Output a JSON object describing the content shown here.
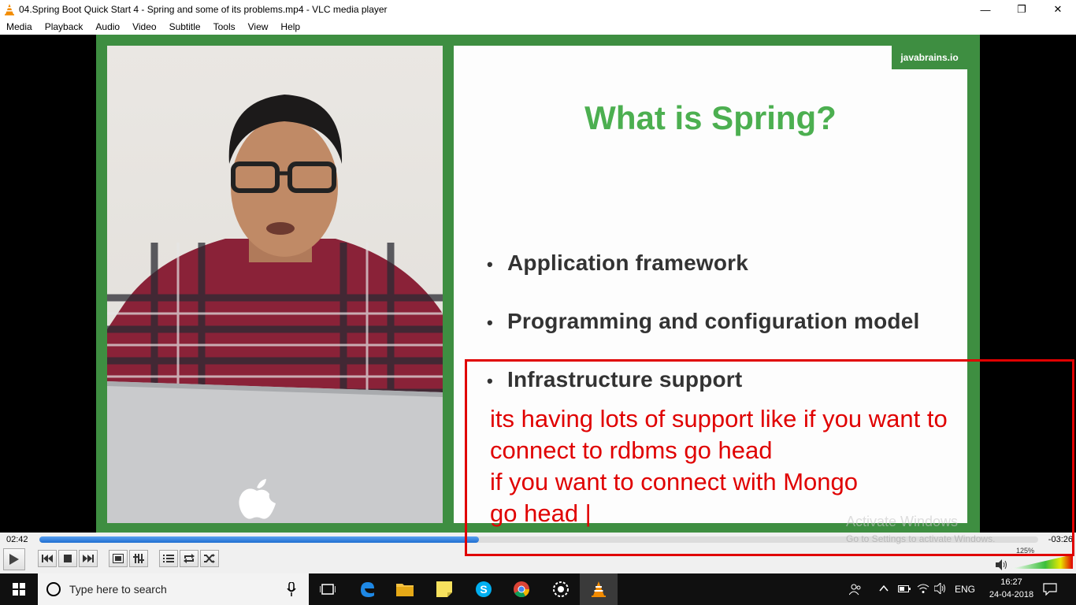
{
  "window": {
    "title": "04.Spring Boot Quick Start 4 - Spring and some of its problems.mp4 - VLC media player",
    "minimize_icon": "minimize-icon",
    "maximize_icon": "restore-icon",
    "close_icon": "close-icon"
  },
  "menu": [
    "Media",
    "Playback",
    "Audio",
    "Video",
    "Subtitle",
    "Tools",
    "View",
    "Help"
  ],
  "slide": {
    "brand": "javabrains.io",
    "title": "What is Spring?",
    "bullets": [
      "Application framework",
      "Programming and configuration model",
      "Infrastructure support"
    ],
    "title_color": "#4caf50",
    "frame_color": "#3e8e41"
  },
  "annotation": {
    "text": "its having lots of support like if you want to\nconnect to rdbms go head\nif you want to connect with Mongo\ngo head |",
    "color": "#e00000"
  },
  "watermark": {
    "line1": "Activate Windows",
    "line2": "Go to Settings to activate Windows."
  },
  "player": {
    "elapsed": "02:42",
    "remaining": "-03:26",
    "progress_fraction": 0.44,
    "volume_label": "125%",
    "volume_fraction": 1.0
  },
  "taskbar": {
    "search_placeholder": "Type here to search",
    "language": "ENG",
    "time": "16:27",
    "date": "24-04-2018"
  }
}
